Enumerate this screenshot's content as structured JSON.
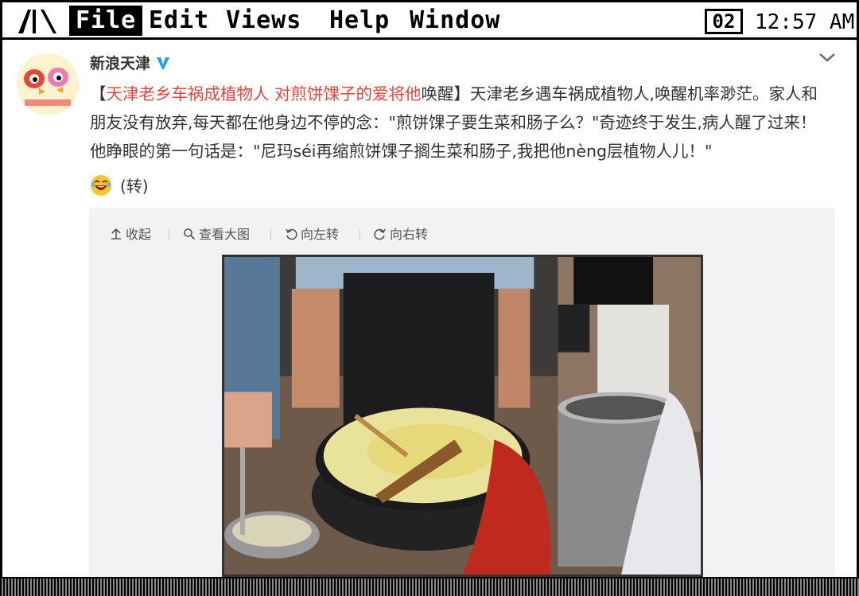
{
  "menubar": {
    "logo": "爪",
    "items": [
      {
        "label": "File"
      },
      {
        "label": "Edit"
      },
      {
        "label": "Views"
      },
      {
        "label": "Help"
      },
      {
        "label": "Window"
      }
    ],
    "window_badge": "02",
    "clock": "12:57 AM"
  },
  "post": {
    "author": "新浪天津",
    "text_open_bracket": "【",
    "text_link": "天津老乡车祸成植物人 对煎饼馃子的爱将他",
    "text_main": "唤醒】天津老乡遇车祸成植物人,唤醒机率渺茫。家人和朋友没有放弃,每天都在他身边不停的念：\"煎饼馃子要生菜和肠子么？\"奇迹终于发生,病人醒了过来！他睁眼的第一句话是：\"尼玛séi再缩煎饼馃子搁生菜和肠子,我把他nèng层植物人儿！\"",
    "repost_note": "(转)",
    "emoji": "laughing-emoji"
  },
  "media": {
    "toolbar": [
      {
        "label": "收起",
        "icon": "collapse-icon"
      },
      {
        "label": "查看大图",
        "icon": "search-icon"
      },
      {
        "label": "向左转",
        "icon": "rotate-left-icon"
      },
      {
        "label": "向右转",
        "icon": "rotate-right-icon"
      }
    ]
  },
  "colors": {
    "link": "#e8443a",
    "verified": "#1da1f2",
    "media_bg": "#f2f2f5"
  }
}
